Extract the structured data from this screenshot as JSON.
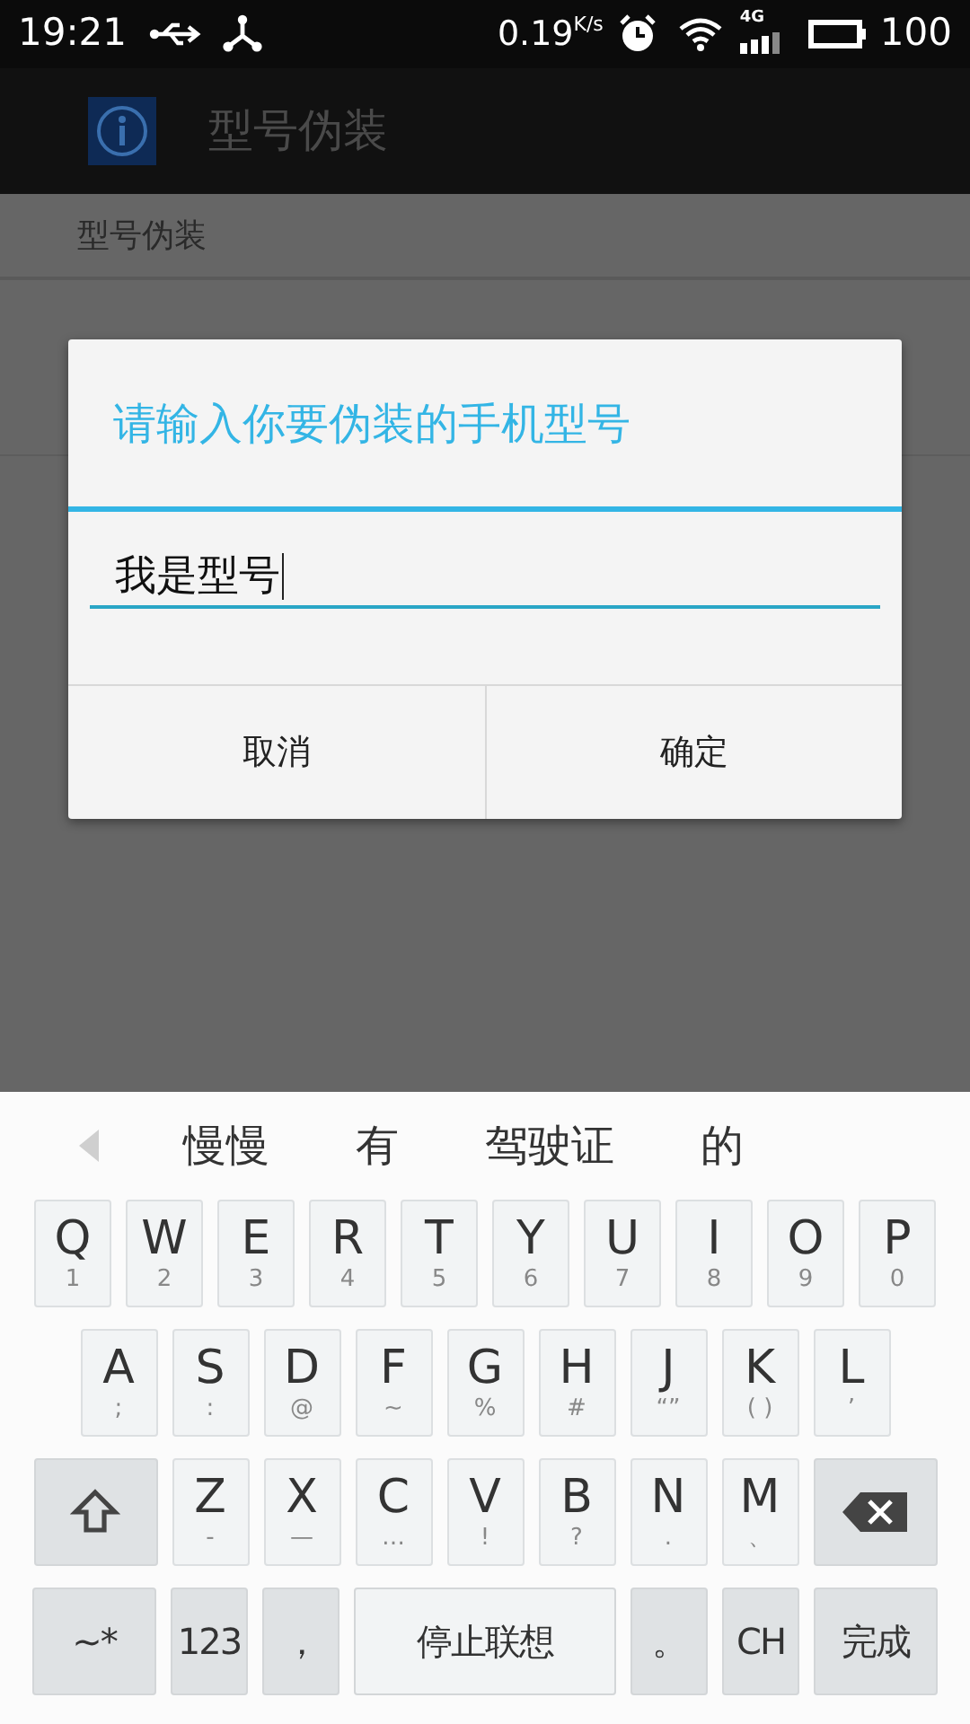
{
  "status_bar": {
    "time": "19:21",
    "speed": "0.19",
    "speed_unit": "K/s",
    "network": "4G",
    "battery": "100"
  },
  "app_bar": {
    "title": "型号伪装"
  },
  "list": {
    "section_header": "型号伪装"
  },
  "dialog": {
    "title": "请输入你要伪装的手机型号",
    "input": {
      "value": "我是型号"
    },
    "buttons": [
      "取消",
      "确定"
    ]
  },
  "keyboard": {
    "candidates": [
      "慢慢",
      "有",
      "驾驶证",
      "的"
    ],
    "rows": [
      {
        "keys": [
          {
            "kind": "letter",
            "label": "Q",
            "sub": "1"
          },
          {
            "kind": "letter",
            "label": "W",
            "sub": "2"
          },
          {
            "kind": "letter",
            "label": "E",
            "sub": "3"
          },
          {
            "kind": "letter",
            "label": "R",
            "sub": "4"
          },
          {
            "kind": "letter",
            "label": "T",
            "sub": "5"
          },
          {
            "kind": "letter",
            "label": "Y",
            "sub": "6"
          },
          {
            "kind": "letter",
            "label": "U",
            "sub": "7"
          },
          {
            "kind": "letter",
            "label": "I",
            "sub": "8"
          },
          {
            "kind": "letter",
            "label": "O",
            "sub": "9"
          },
          {
            "kind": "letter",
            "label": "P",
            "sub": "0"
          }
        ]
      },
      {
        "keys": [
          {
            "kind": "letter",
            "label": "A",
            "sub": ";"
          },
          {
            "kind": "letter",
            "label": "S",
            "sub": ":"
          },
          {
            "kind": "letter",
            "label": "D",
            "sub": "@"
          },
          {
            "kind": "letter",
            "label": "F",
            "sub": "~"
          },
          {
            "kind": "letter",
            "label": "G",
            "sub": "%"
          },
          {
            "kind": "letter",
            "label": "H",
            "sub": "#"
          },
          {
            "kind": "letter",
            "label": "J",
            "sub": "“”"
          },
          {
            "kind": "letter",
            "label": "K",
            "sub": "( )"
          },
          {
            "kind": "letter",
            "label": "L",
            "sub": "’"
          }
        ]
      },
      {
        "keys": [
          {
            "kind": "shift"
          },
          {
            "kind": "letter",
            "label": "Z",
            "sub": "-"
          },
          {
            "kind": "letter",
            "label": "X",
            "sub": "—"
          },
          {
            "kind": "letter",
            "label": "C",
            "sub": "…"
          },
          {
            "kind": "letter",
            "label": "V",
            "sub": "!"
          },
          {
            "kind": "letter",
            "label": "B",
            "sub": "?"
          },
          {
            "kind": "letter",
            "label": "N",
            "sub": "."
          },
          {
            "kind": "letter",
            "label": "M",
            "sub": "、"
          },
          {
            "kind": "backspace"
          }
        ]
      },
      {
        "keys": [
          {
            "kind": "wide",
            "label": "~*"
          },
          {
            "kind": "function",
            "label": "123"
          },
          {
            "kind": "function",
            "label": "，"
          },
          {
            "kind": "space",
            "label": "停止联想"
          },
          {
            "kind": "function",
            "label": "。"
          },
          {
            "kind": "function",
            "label": "CH"
          },
          {
            "kind": "wide",
            "label": "完成"
          }
        ]
      }
    ]
  }
}
